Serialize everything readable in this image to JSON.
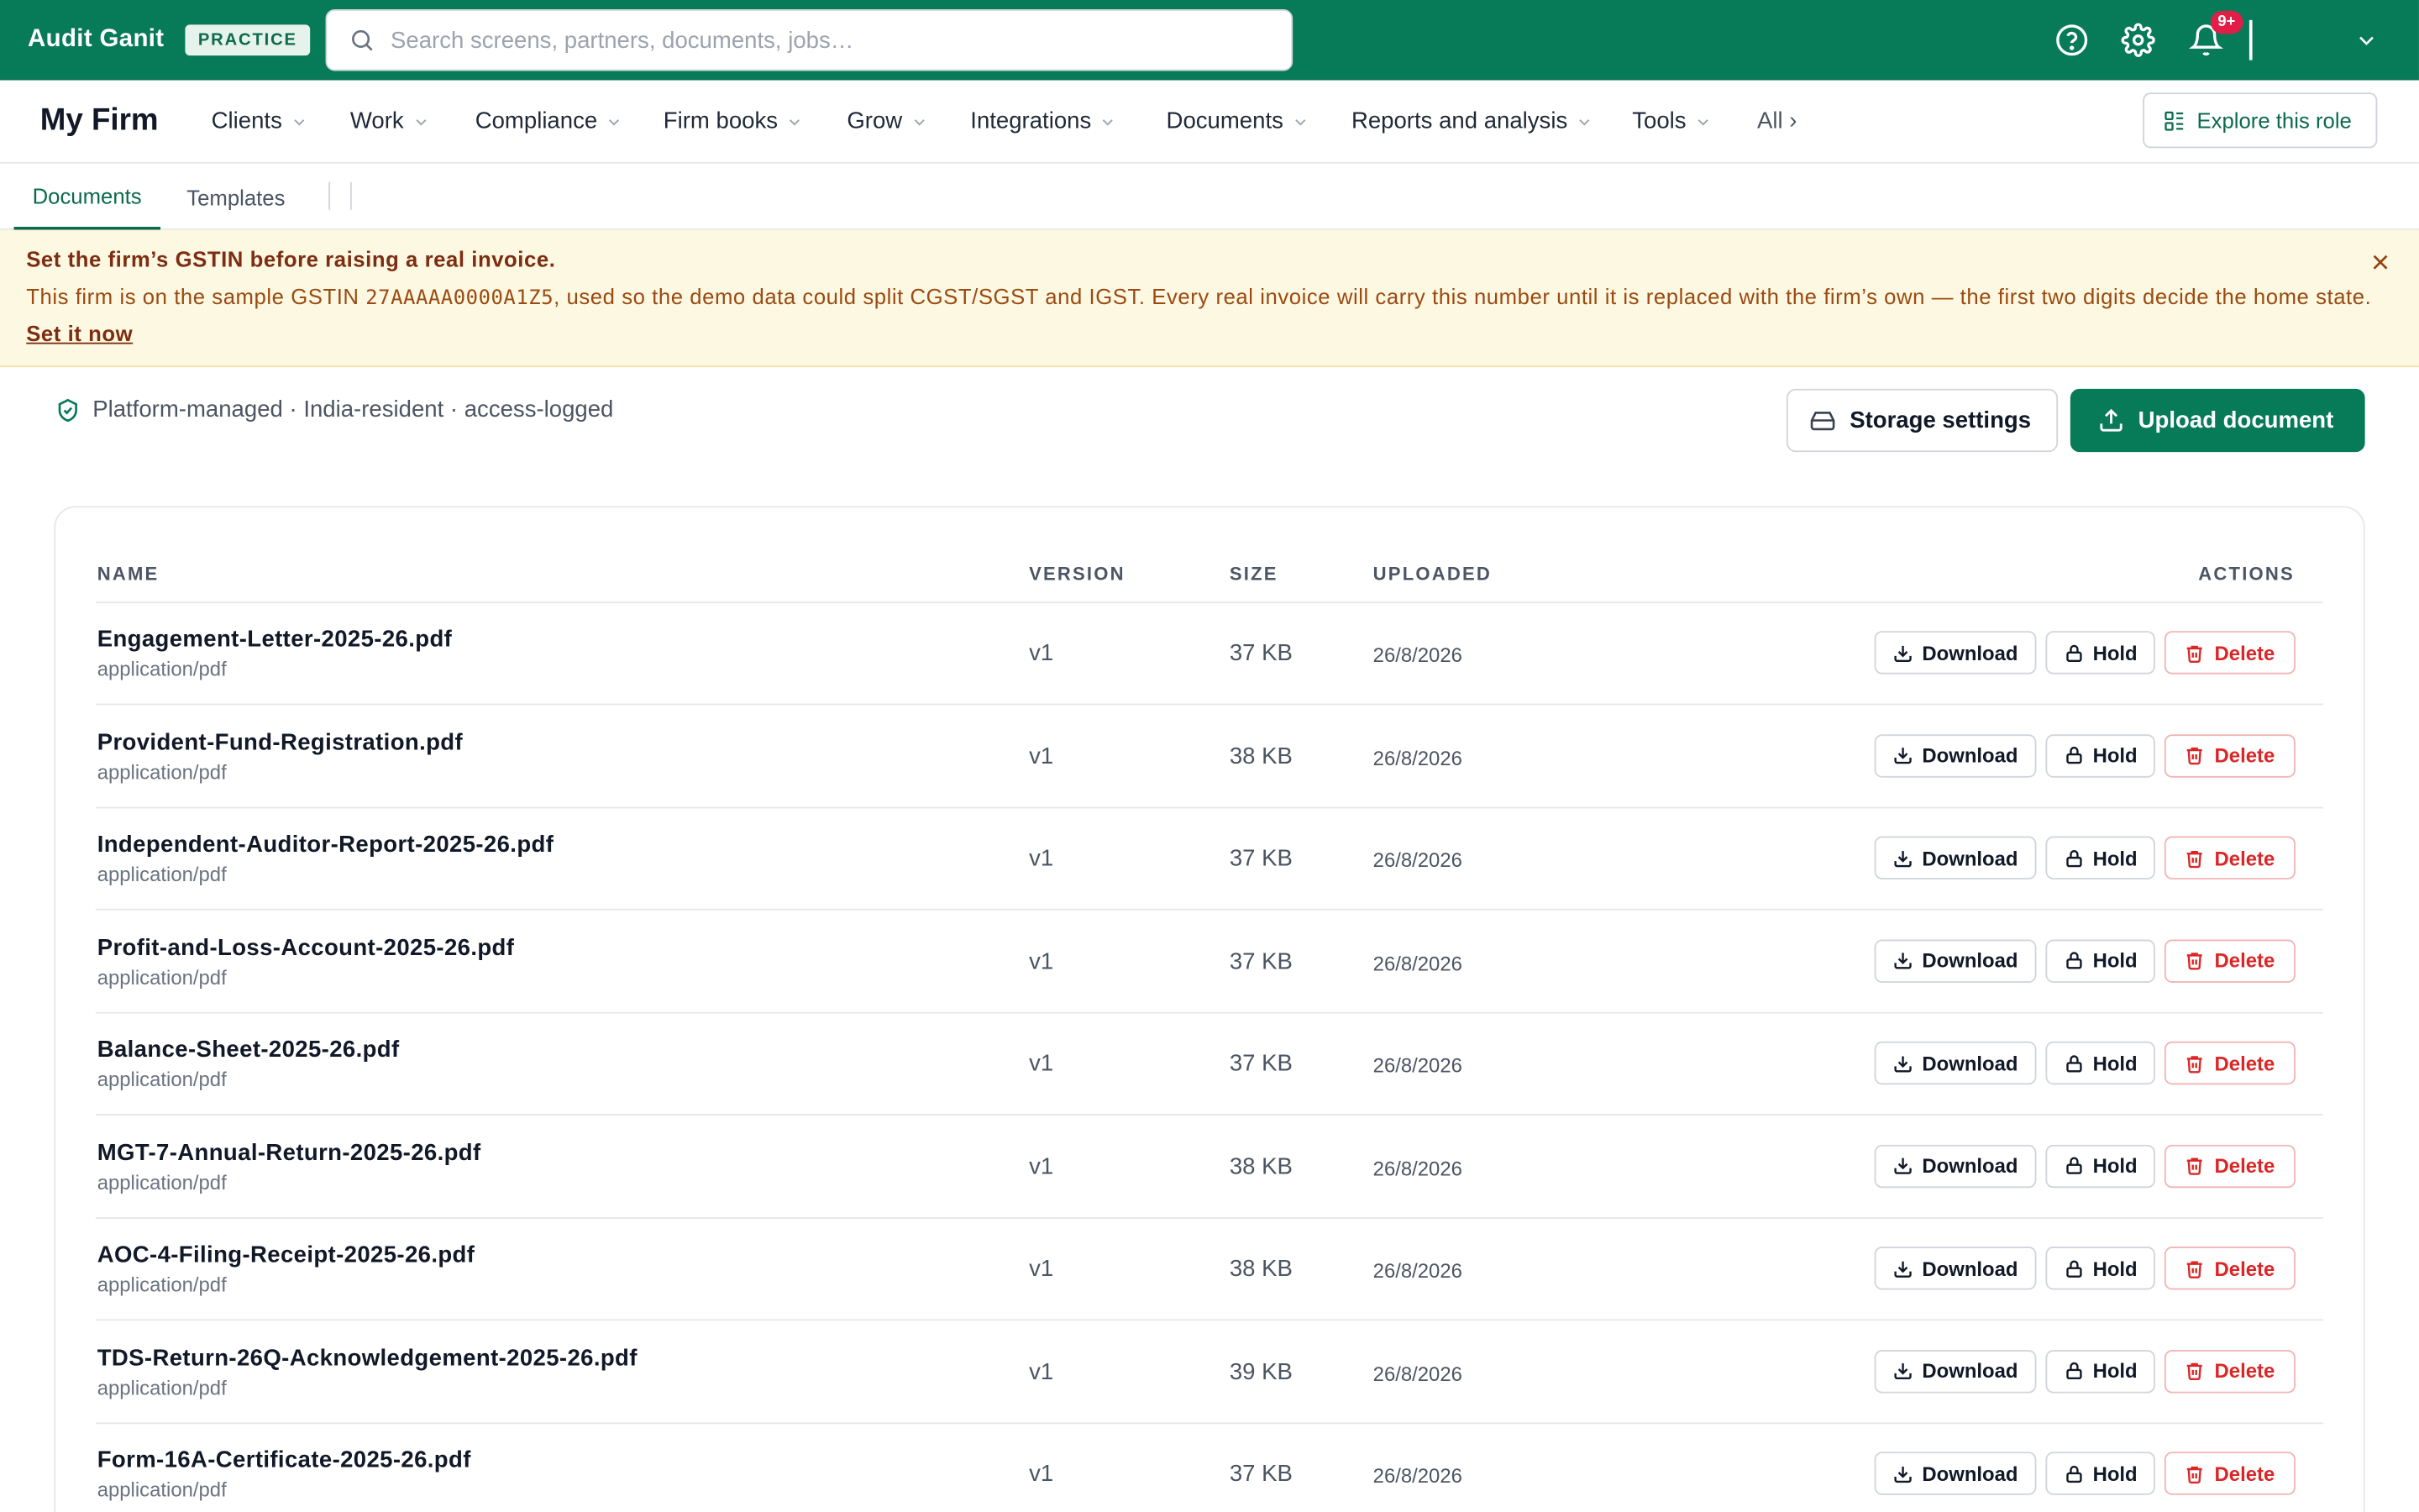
{
  "topbar": {
    "brand": "Audit Ganit",
    "badge": "PRACTICE",
    "search_placeholder": "Search screens, partners, documents, jobs…",
    "notifications_count": "9+",
    "icons": [
      "help-icon",
      "gear-icon",
      "bell-icon",
      "chevron-down-icon"
    ]
  },
  "nav": {
    "firm_title": "My Firm",
    "items": [
      "Clients",
      "Work",
      "Compliance",
      "Firm books",
      "Grow",
      "Integrations",
      "Documents",
      "Reports and analysis",
      "Tools"
    ],
    "all_label": "All ›",
    "explore_label": "Explore this role"
  },
  "tabs": [
    "Documents",
    "Templates"
  ],
  "banner": {
    "title": "Set the firm’s GSTIN before raising a real invoice.",
    "text_before": "This firm is on the sample GSTIN ",
    "gstin": "27AAAAA0000A1Z5",
    "text_after": ", used so the demo data could split CGST/SGST and IGST. Every real invoice will carry this number until it is replaced with the firm’s own — the first two digits decide the home state.",
    "link": "Set it now"
  },
  "storage_note": "Platform-managed · India-resident · access-logged",
  "buttons": {
    "storage_settings": "Storage settings",
    "upload_document": "Upload document"
  },
  "table": {
    "headers": {
      "name": "NAME",
      "version": "VERSION",
      "size": "SIZE",
      "uploaded": "UPLOADED",
      "actions": "ACTIONS"
    },
    "action_labels": {
      "download": "Download",
      "hold": "Hold",
      "delete": "Delete"
    },
    "rows": [
      {
        "name": "Engagement-Letter-2025-26.pdf",
        "type": "application/pdf",
        "version": "v1",
        "size": "37 KB",
        "uploaded": "26/8/2026"
      },
      {
        "name": "Provident-Fund-Registration.pdf",
        "type": "application/pdf",
        "version": "v1",
        "size": "38 KB",
        "uploaded": "26/8/2026"
      },
      {
        "name": "Independent-Auditor-Report-2025-26.pdf",
        "type": "application/pdf",
        "version": "v1",
        "size": "37 KB",
        "uploaded": "26/8/2026"
      },
      {
        "name": "Profit-and-Loss-Account-2025-26.pdf",
        "type": "application/pdf",
        "version": "v1",
        "size": "37 KB",
        "uploaded": "26/8/2026"
      },
      {
        "name": "Balance-Sheet-2025-26.pdf",
        "type": "application/pdf",
        "version": "v1",
        "size": "37 KB",
        "uploaded": "26/8/2026"
      },
      {
        "name": "MGT-7-Annual-Return-2025-26.pdf",
        "type": "application/pdf",
        "version": "v1",
        "size": "38 KB",
        "uploaded": "26/8/2026"
      },
      {
        "name": "AOC-4-Filing-Receipt-2025-26.pdf",
        "type": "application/pdf",
        "version": "v1",
        "size": "38 KB",
        "uploaded": "26/8/2026"
      },
      {
        "name": "TDS-Return-26Q-Acknowledgement-2025-26.pdf",
        "type": "application/pdf",
        "version": "v1",
        "size": "39 KB",
        "uploaded": "26/8/2026"
      },
      {
        "name": "Form-16A-Certificate-2025-26.pdf",
        "type": "application/pdf",
        "version": "v1",
        "size": "37 KB",
        "uploaded": "26/8/2026"
      }
    ]
  },
  "colors": {
    "brand_green": "#077a57",
    "banner_bg": "#fdf8e1",
    "danger": "#dc2626",
    "badge_red": "#e11d48"
  }
}
